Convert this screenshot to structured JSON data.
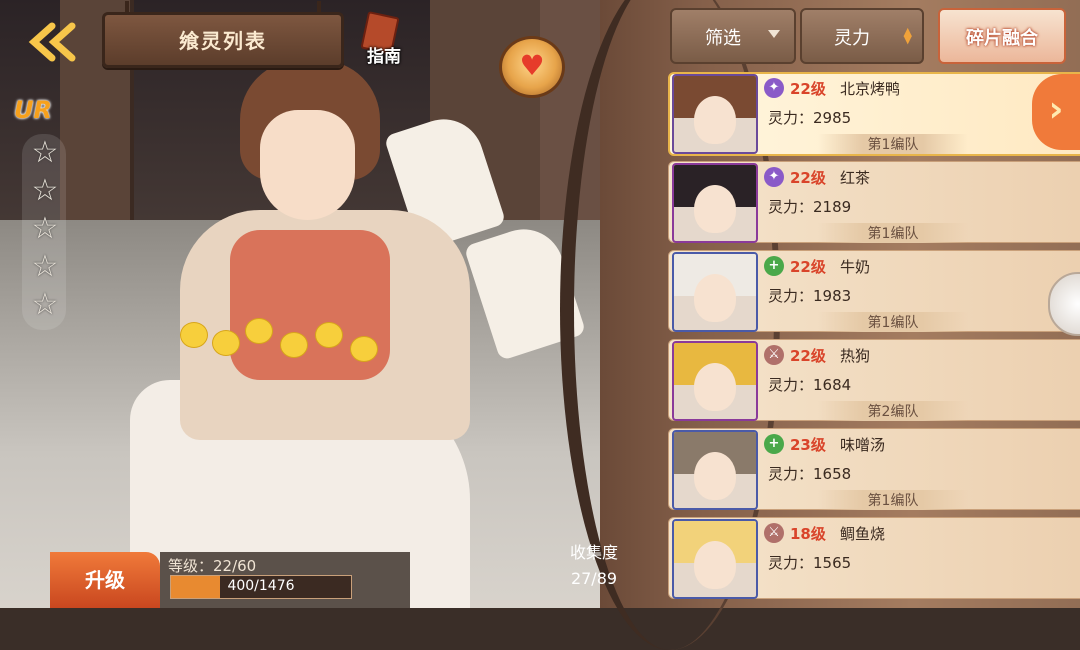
{
  "header": {
    "title": "飨灵列表",
    "guide_label": "指南"
  },
  "hero": {
    "rarity": "UR",
    "stars_total": 5
  },
  "level_panel": {
    "upgrade_label": "升级",
    "level_text": "等级：22/60",
    "exp_text": "400/1476",
    "exp_fraction": 0.271
  },
  "collection": {
    "label": "收集度",
    "value": "27/89"
  },
  "toolbar": {
    "filter_label": "筛选",
    "sort_label": "灵力",
    "fuse_label": "碎片融合"
  },
  "roster": [
    {
      "level": "22级",
      "name": "北京烤鸭",
      "power": "灵力：2985",
      "team": "第1编队",
      "type_icon": "purple-sparkle-icon",
      "selected": true
    },
    {
      "level": "22级",
      "name": "红茶",
      "power": "灵力：2189",
      "team": "第1编队",
      "type_icon": "purple-sparkle-icon"
    },
    {
      "level": "22级",
      "name": "牛奶",
      "power": "灵力：1983",
      "team": "第1编队",
      "type_icon": "green-plus-icon"
    },
    {
      "level": "22级",
      "name": "热狗",
      "power": "灵力：1684",
      "team": "第2编队",
      "type_icon": "sword-icon"
    },
    {
      "level": "23级",
      "name": "味噌汤",
      "power": "灵力：1658",
      "team": "第1编队",
      "type_icon": "green-plus-icon"
    },
    {
      "level": "18级",
      "name": "鲷鱼烧",
      "power": "灵力：1565",
      "team": "",
      "type_icon": "sword-icon"
    }
  ],
  "colors": {
    "accent_orange": "#f07a3a",
    "level_red": "#d9442a"
  }
}
